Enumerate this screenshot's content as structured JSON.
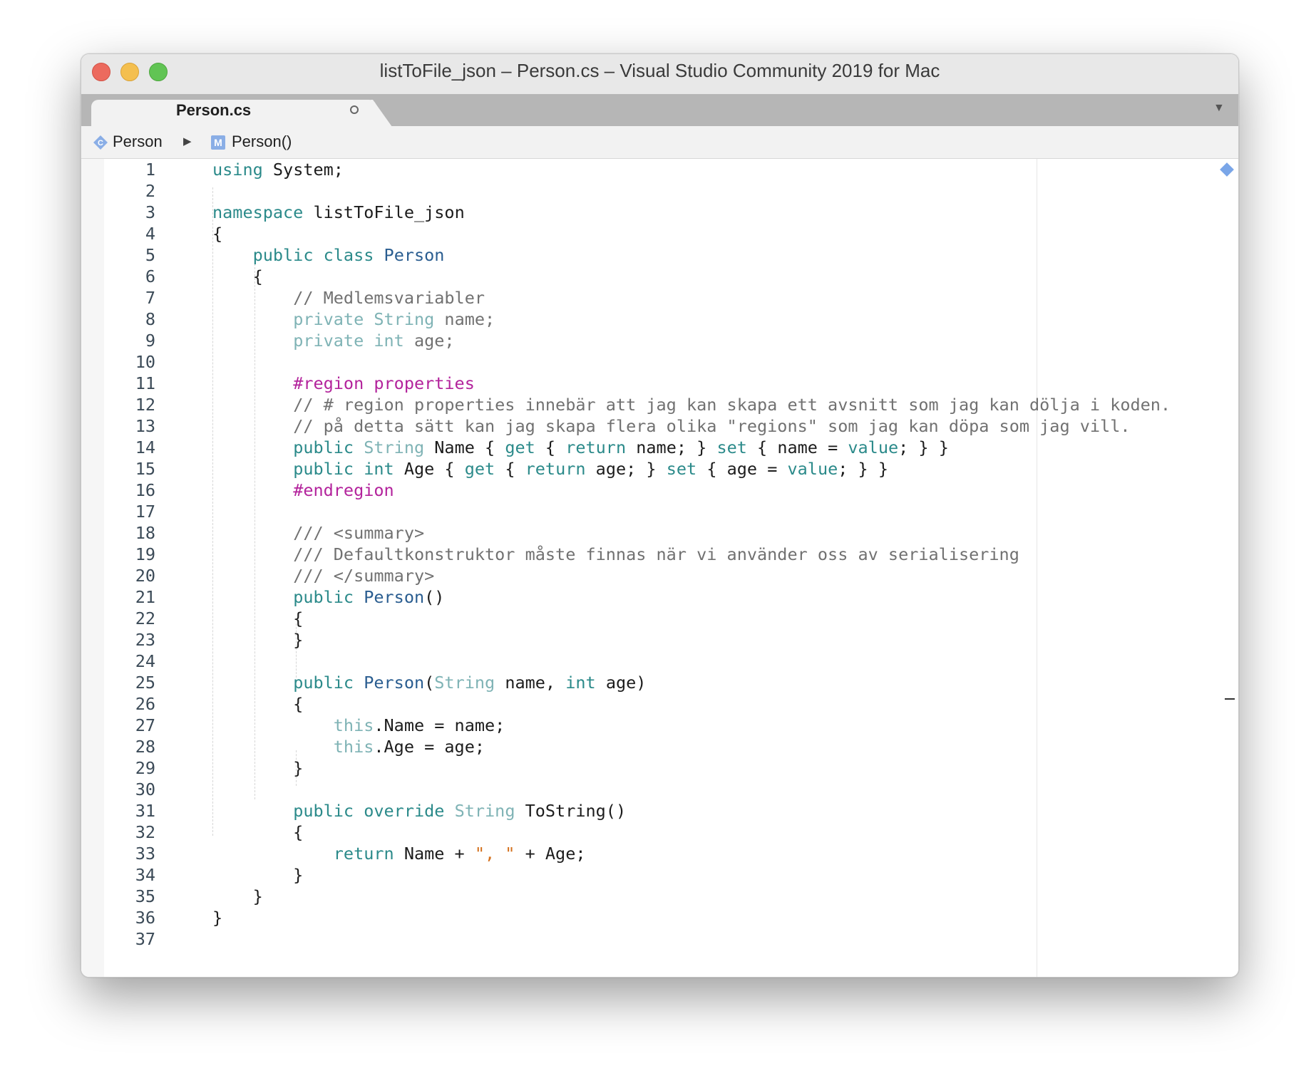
{
  "window": {
    "title": "listToFile_json – Person.cs – Visual Studio Community 2019 for Mac"
  },
  "tab": {
    "label": "Person.cs"
  },
  "breadcrumb": {
    "class_name": "Person",
    "member_name": "Person()"
  },
  "icons": {
    "close": "close-button",
    "minimize": "minimize-button",
    "zoom": "zoom-button",
    "tab_close": "tab-close-icon",
    "tab_menu": "chevron-down-icon",
    "class": "class-icon",
    "method": "method-icon",
    "separator": "play-arrow-icon",
    "marker": "bookmark-diamond-icon"
  },
  "code": {
    "lines": [
      [
        {
          "t": "using",
          "c": "kw"
        },
        {
          "t": " System;"
        }
      ],
      [],
      [
        {
          "t": "namespace",
          "c": "kw"
        },
        {
          "t": " listToFile_json"
        }
      ],
      [
        {
          "t": "{"
        }
      ],
      [
        {
          "t": "    "
        },
        {
          "t": "public",
          "c": "kw"
        },
        {
          "t": " "
        },
        {
          "t": "class",
          "c": "kw"
        },
        {
          "t": " "
        },
        {
          "t": "Person",
          "c": "typ"
        }
      ],
      [
        {
          "t": "    {"
        }
      ],
      [
        {
          "t": "        "
        },
        {
          "t": "// Medlemsvariabler",
          "c": "cm"
        }
      ],
      [
        {
          "t": "        "
        },
        {
          "t": "private",
          "c": "kwl"
        },
        {
          "t": " "
        },
        {
          "t": "String",
          "c": "kwl"
        },
        {
          "t": " name;",
          "c": "cm"
        }
      ],
      [
        {
          "t": "        "
        },
        {
          "t": "private",
          "c": "kwl"
        },
        {
          "t": " "
        },
        {
          "t": "int",
          "c": "kwl"
        },
        {
          "t": " age;",
          "c": "cm"
        }
      ],
      [],
      [
        {
          "t": "        "
        },
        {
          "t": "#region properties",
          "c": "pp"
        }
      ],
      [
        {
          "t": "        "
        },
        {
          "t": "// # region properties innebär att jag kan skapa ett avsnitt som jag kan dölja i koden.",
          "c": "cm"
        }
      ],
      [
        {
          "t": "        "
        },
        {
          "t": "// på detta sätt kan jag skapa flera olika \"regions\" som jag kan döpa som jag vill.",
          "c": "cm"
        }
      ],
      [
        {
          "t": "        "
        },
        {
          "t": "public",
          "c": "kw"
        },
        {
          "t": " "
        },
        {
          "t": "String",
          "c": "kwl"
        },
        {
          "t": " Name { "
        },
        {
          "t": "get",
          "c": "kw"
        },
        {
          "t": " { "
        },
        {
          "t": "return",
          "c": "kw"
        },
        {
          "t": " name; } "
        },
        {
          "t": "set",
          "c": "kw"
        },
        {
          "t": " { name = "
        },
        {
          "t": "value",
          "c": "kw"
        },
        {
          "t": "; } }"
        }
      ],
      [
        {
          "t": "        "
        },
        {
          "t": "public",
          "c": "kw"
        },
        {
          "t": " "
        },
        {
          "t": "int",
          "c": "kw"
        },
        {
          "t": " Age { "
        },
        {
          "t": "get",
          "c": "kw"
        },
        {
          "t": " { "
        },
        {
          "t": "return",
          "c": "kw"
        },
        {
          "t": " age; } "
        },
        {
          "t": "set",
          "c": "kw"
        },
        {
          "t": " { age = "
        },
        {
          "t": "value",
          "c": "kw"
        },
        {
          "t": "; } }"
        }
      ],
      [
        {
          "t": "        "
        },
        {
          "t": "#endregion",
          "c": "pp"
        }
      ],
      [],
      [
        {
          "t": "        "
        },
        {
          "t": "/// <summary>",
          "c": "cm"
        }
      ],
      [
        {
          "t": "        "
        },
        {
          "t": "/// Defaultkonstruktor måste finnas när vi använder oss av serialisering",
          "c": "cm"
        }
      ],
      [
        {
          "t": "        "
        },
        {
          "t": "/// </summary>",
          "c": "cm"
        }
      ],
      [
        {
          "t": "        "
        },
        {
          "t": "public",
          "c": "kw"
        },
        {
          "t": " "
        },
        {
          "t": "Person",
          "c": "typ"
        },
        {
          "t": "()"
        }
      ],
      [
        {
          "t": "        {"
        }
      ],
      [
        {
          "t": "        }"
        }
      ],
      [],
      [
        {
          "t": "        "
        },
        {
          "t": "public",
          "c": "kw"
        },
        {
          "t": " "
        },
        {
          "t": "Person",
          "c": "typ"
        },
        {
          "t": "("
        },
        {
          "t": "String",
          "c": "kwl"
        },
        {
          "t": " name, "
        },
        {
          "t": "int",
          "c": "kw"
        },
        {
          "t": " age)"
        }
      ],
      [
        {
          "t": "        {"
        }
      ],
      [
        {
          "t": "            "
        },
        {
          "t": "this",
          "c": "kwl"
        },
        {
          "t": ".Name = name;"
        }
      ],
      [
        {
          "t": "            "
        },
        {
          "t": "this",
          "c": "kwl"
        },
        {
          "t": ".Age = age;"
        }
      ],
      [
        {
          "t": "        }"
        }
      ],
      [],
      [
        {
          "t": "        "
        },
        {
          "t": "public",
          "c": "kw"
        },
        {
          "t": " "
        },
        {
          "t": "override",
          "c": "kw"
        },
        {
          "t": " "
        },
        {
          "t": "String",
          "c": "kwl"
        },
        {
          "t": " ToString()"
        }
      ],
      [
        {
          "t": "        {"
        }
      ],
      [
        {
          "t": "            "
        },
        {
          "t": "return",
          "c": "kw"
        },
        {
          "t": " Name + "
        },
        {
          "t": "\", \"",
          "c": "str"
        },
        {
          "t": " + Age;"
        }
      ],
      [
        {
          "t": "        }"
        }
      ],
      [
        {
          "t": "    }"
        }
      ],
      [
        {
          "t": "}"
        }
      ],
      []
    ]
  }
}
